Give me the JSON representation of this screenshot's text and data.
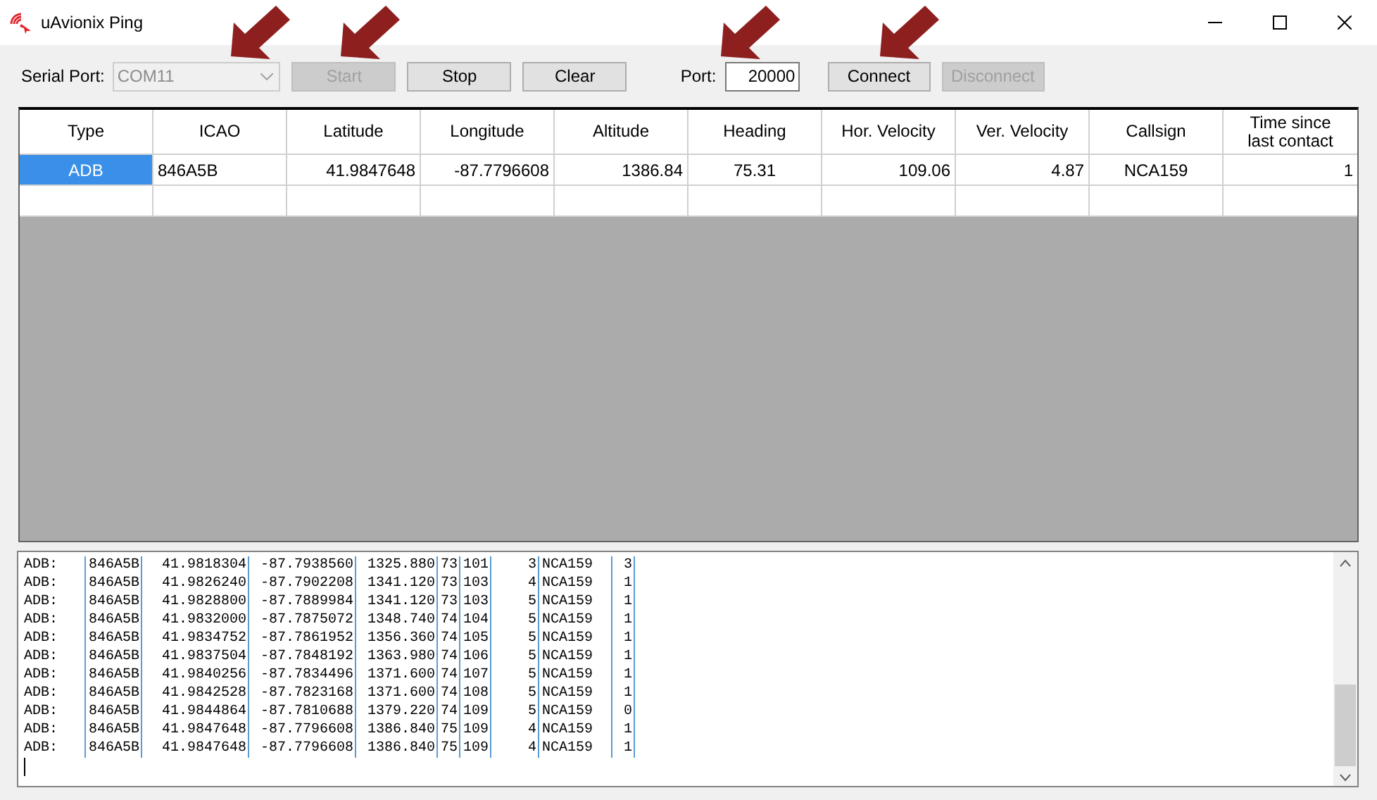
{
  "window": {
    "title": "uAvionix Ping"
  },
  "toolbar": {
    "serial_port_label": "Serial Port:",
    "serial_port": {
      "value": "COM11",
      "disabled": true
    },
    "buttons": [
      {
        "label": "Start",
        "disabled": true
      },
      {
        "label": "Stop",
        "disabled": false
      },
      {
        "label": "Clear",
        "disabled": false
      }
    ],
    "port_label": "Port:",
    "port": {
      "value": "20000"
    },
    "net_buttons": [
      {
        "label": "Connect",
        "disabled": false
      },
      {
        "label": "Disconnect",
        "disabled": true
      }
    ]
  },
  "table": {
    "columns": [
      "Type",
      "ICAO",
      "Latitude",
      "Longitude",
      "Altitude",
      "Heading",
      "Hor. Velocity",
      "Ver. Velocity",
      "Callsign",
      "Time since last contact"
    ],
    "rows": [
      {
        "selected": true,
        "cells": [
          "ADB",
          "846A5B",
          "41.9847648",
          "-87.7796608",
          "1386.84",
          "75.31",
          "109.06",
          "4.87",
          "NCA159",
          "1"
        ]
      }
    ]
  },
  "log": {
    "lines": [
      [
        "ADB:",
        "846A5B",
        "41.9818304",
        "-87.7938560",
        "1325.880",
        "73",
        "101",
        "3",
        "NCA159",
        "3"
      ],
      [
        "ADB:",
        "846A5B",
        "41.9826240",
        "-87.7902208",
        "1341.120",
        "73",
        "103",
        "4",
        "NCA159",
        "1"
      ],
      [
        "ADB:",
        "846A5B",
        "41.9828800",
        "-87.7889984",
        "1341.120",
        "73",
        "103",
        "5",
        "NCA159",
        "1"
      ],
      [
        "ADB:",
        "846A5B",
        "41.9832000",
        "-87.7875072",
        "1348.740",
        "74",
        "104",
        "5",
        "NCA159",
        "1"
      ],
      [
        "ADB:",
        "846A5B",
        "41.9834752",
        "-87.7861952",
        "1356.360",
        "74",
        "105",
        "5",
        "NCA159",
        "1"
      ],
      [
        "ADB:",
        "846A5B",
        "41.9837504",
        "-87.7848192",
        "1363.980",
        "74",
        "106",
        "5",
        "NCA159",
        "1"
      ],
      [
        "ADB:",
        "846A5B",
        "41.9840256",
        "-87.7834496",
        "1371.600",
        "74",
        "107",
        "5",
        "NCA159",
        "1"
      ],
      [
        "ADB:",
        "846A5B",
        "41.9842528",
        "-87.7823168",
        "1371.600",
        "74",
        "108",
        "5",
        "NCA159",
        "1"
      ],
      [
        "ADB:",
        "846A5B",
        "41.9844864",
        "-87.7810688",
        "1379.220",
        "74",
        "109",
        "5",
        "NCA159",
        "0"
      ],
      [
        "ADB:",
        "846A5B",
        "41.9847648",
        "-87.7796608",
        "1386.840",
        "75",
        "109",
        "4",
        "NCA159",
        "1"
      ],
      [
        "ADB:",
        "846A5B",
        "41.9847648",
        "-87.7796608",
        "1386.840",
        "75",
        "109",
        "4",
        "NCA159",
        "1"
      ]
    ]
  }
}
